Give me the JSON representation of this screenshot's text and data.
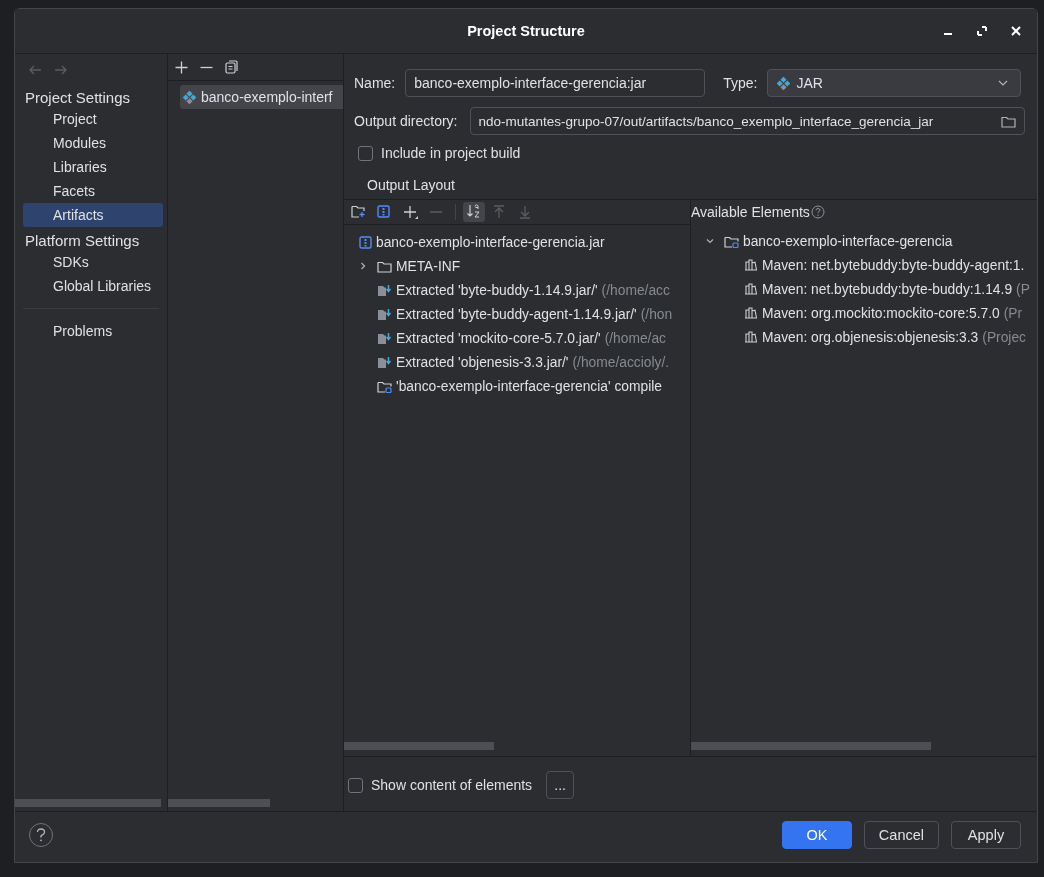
{
  "window": {
    "title": "Project Structure"
  },
  "sidebar": {
    "sections": [
      {
        "title": "Project Settings",
        "items": [
          {
            "label": "Project",
            "selected": false
          },
          {
            "label": "Modules",
            "selected": false
          },
          {
            "label": "Libraries",
            "selected": false
          },
          {
            "label": "Facets",
            "selected": false
          },
          {
            "label": "Artifacts",
            "selected": true
          }
        ]
      },
      {
        "title": "Platform Settings",
        "items": [
          {
            "label": "SDKs",
            "selected": false
          },
          {
            "label": "Global Libraries",
            "selected": false
          }
        ]
      }
    ],
    "extra_items": [
      {
        "label": "Problems",
        "selected": false
      }
    ]
  },
  "artifacts": [
    {
      "label": "banco-exemplo-interf",
      "selected": true
    }
  ],
  "form": {
    "name_label": "Name:",
    "name_value": "banco-exemplo-interface-gerencia:jar",
    "type_label": "Type:",
    "type_value": "JAR",
    "output_label": "Output directory:",
    "output_value": "ndo-mutantes-grupo-07/out/artifacts/banco_exemplo_interface_gerencia_jar",
    "include_label": "Include in project build",
    "include_checked": false
  },
  "output_layout": {
    "title": "Output Layout",
    "toolbar": [
      {
        "kind": "new-folder",
        "selected": false
      },
      {
        "kind": "archive",
        "selected": false
      },
      {
        "kind": "add",
        "selected": false
      },
      {
        "kind": "remove",
        "selected": false
      },
      {
        "kind": "sort",
        "selected": true
      },
      {
        "kind": "up",
        "selected": false
      },
      {
        "kind": "down",
        "selected": false
      }
    ],
    "tree": [
      {
        "kind": "jar",
        "label": "banco-exemplo-interface-gerencia.jar"
      },
      {
        "kind": "folder",
        "label": "META-INF",
        "expanded": false
      },
      {
        "kind": "extracted",
        "label": "Extracted 'byte-buddy-1.14.9.jar/'",
        "detail": "(/home/acc"
      },
      {
        "kind": "extracted",
        "label": "Extracted 'byte-buddy-agent-1.14.9.jar/'",
        "detail": "(/hon"
      },
      {
        "kind": "extracted",
        "label": "Extracted 'mockito-core-5.7.0.jar/'",
        "detail": "(/home/ac"
      },
      {
        "kind": "extracted",
        "label": "Extracted 'objenesis-3.3.jar/'",
        "detail": "(/home/accioly/."
      },
      {
        "kind": "module",
        "label": "'banco-exemplo-interface-gerencia' compile"
      }
    ]
  },
  "available": {
    "title": "Available Elements",
    "tree": [
      {
        "label": "banco-exemplo-interface-gerencia",
        "expanded": true,
        "children": [
          {
            "label": "Maven: net.bytebuddy:byte-buddy-agent:1."
          },
          {
            "label": "Maven: net.bytebuddy:byte-buddy:1.14.9",
            "detail": "(P"
          },
          {
            "label": "Maven: org.mockito:mockito-core:5.7.0",
            "detail": "(Pr"
          },
          {
            "label": "Maven: org.objenesis:objenesis:3.3",
            "detail": "(Projec"
          }
        ]
      }
    ]
  },
  "show_content": {
    "label": "Show content of elements",
    "checked": false,
    "button": "..."
  },
  "buttons": [
    {
      "label": "OK",
      "kind": "primary"
    },
    {
      "label": "Cancel",
      "kind": "normal"
    },
    {
      "label": "Apply",
      "kind": "normal"
    }
  ]
}
